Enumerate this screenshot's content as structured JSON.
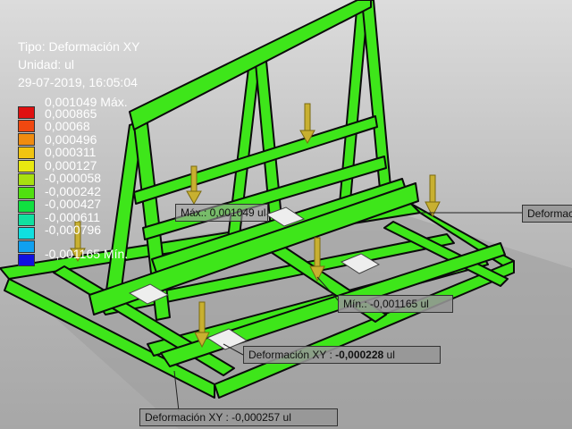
{
  "hud": {
    "type_line": "Tipo: Deformación XY",
    "unit_line": "Unidad: ul",
    "timestamp": "29-07-2019, 16:05:04"
  },
  "legend": {
    "entries": [
      {
        "label": "0,001049 Máx.",
        "color": "#e01010"
      },
      {
        "label": "0,000865",
        "color": "#f04810"
      },
      {
        "label": "0,00068",
        "color": "#f08c10"
      },
      {
        "label": "0,000496",
        "color": "#f0c410"
      },
      {
        "label": "0,000311",
        "color": "#e8e810"
      },
      {
        "label": "0,000127",
        "color": "#a8e010"
      },
      {
        "label": "-0,000058",
        "color": "#50e010"
      },
      {
        "label": "-0,000242",
        "color": "#10e040"
      },
      {
        "label": "-0,000427",
        "color": "#10e0a0"
      },
      {
        "label": "-0,000611",
        "color": "#10e0e0"
      },
      {
        "label": "-0,000796",
        "color": "#10a0f0"
      },
      {
        "label": "-0,001165 Mín.",
        "color": "#1010e0"
      }
    ]
  },
  "probes": {
    "max_label": "Máx.: 0,001049 ul",
    "min_label": "Mín.: -0,001165 ul",
    "deform_right": "Deformación",
    "deform_mid_label": "Deformación XY : ",
    "deform_mid_value": "-0,000228",
    "deform_mid_unit": " ul",
    "deform_bottom": "Deformación XY : -0,000257 ul"
  },
  "colors": {
    "structure": "#3ee61a",
    "background": "#c4c4c4",
    "load_arrow": "#c8b030"
  }
}
